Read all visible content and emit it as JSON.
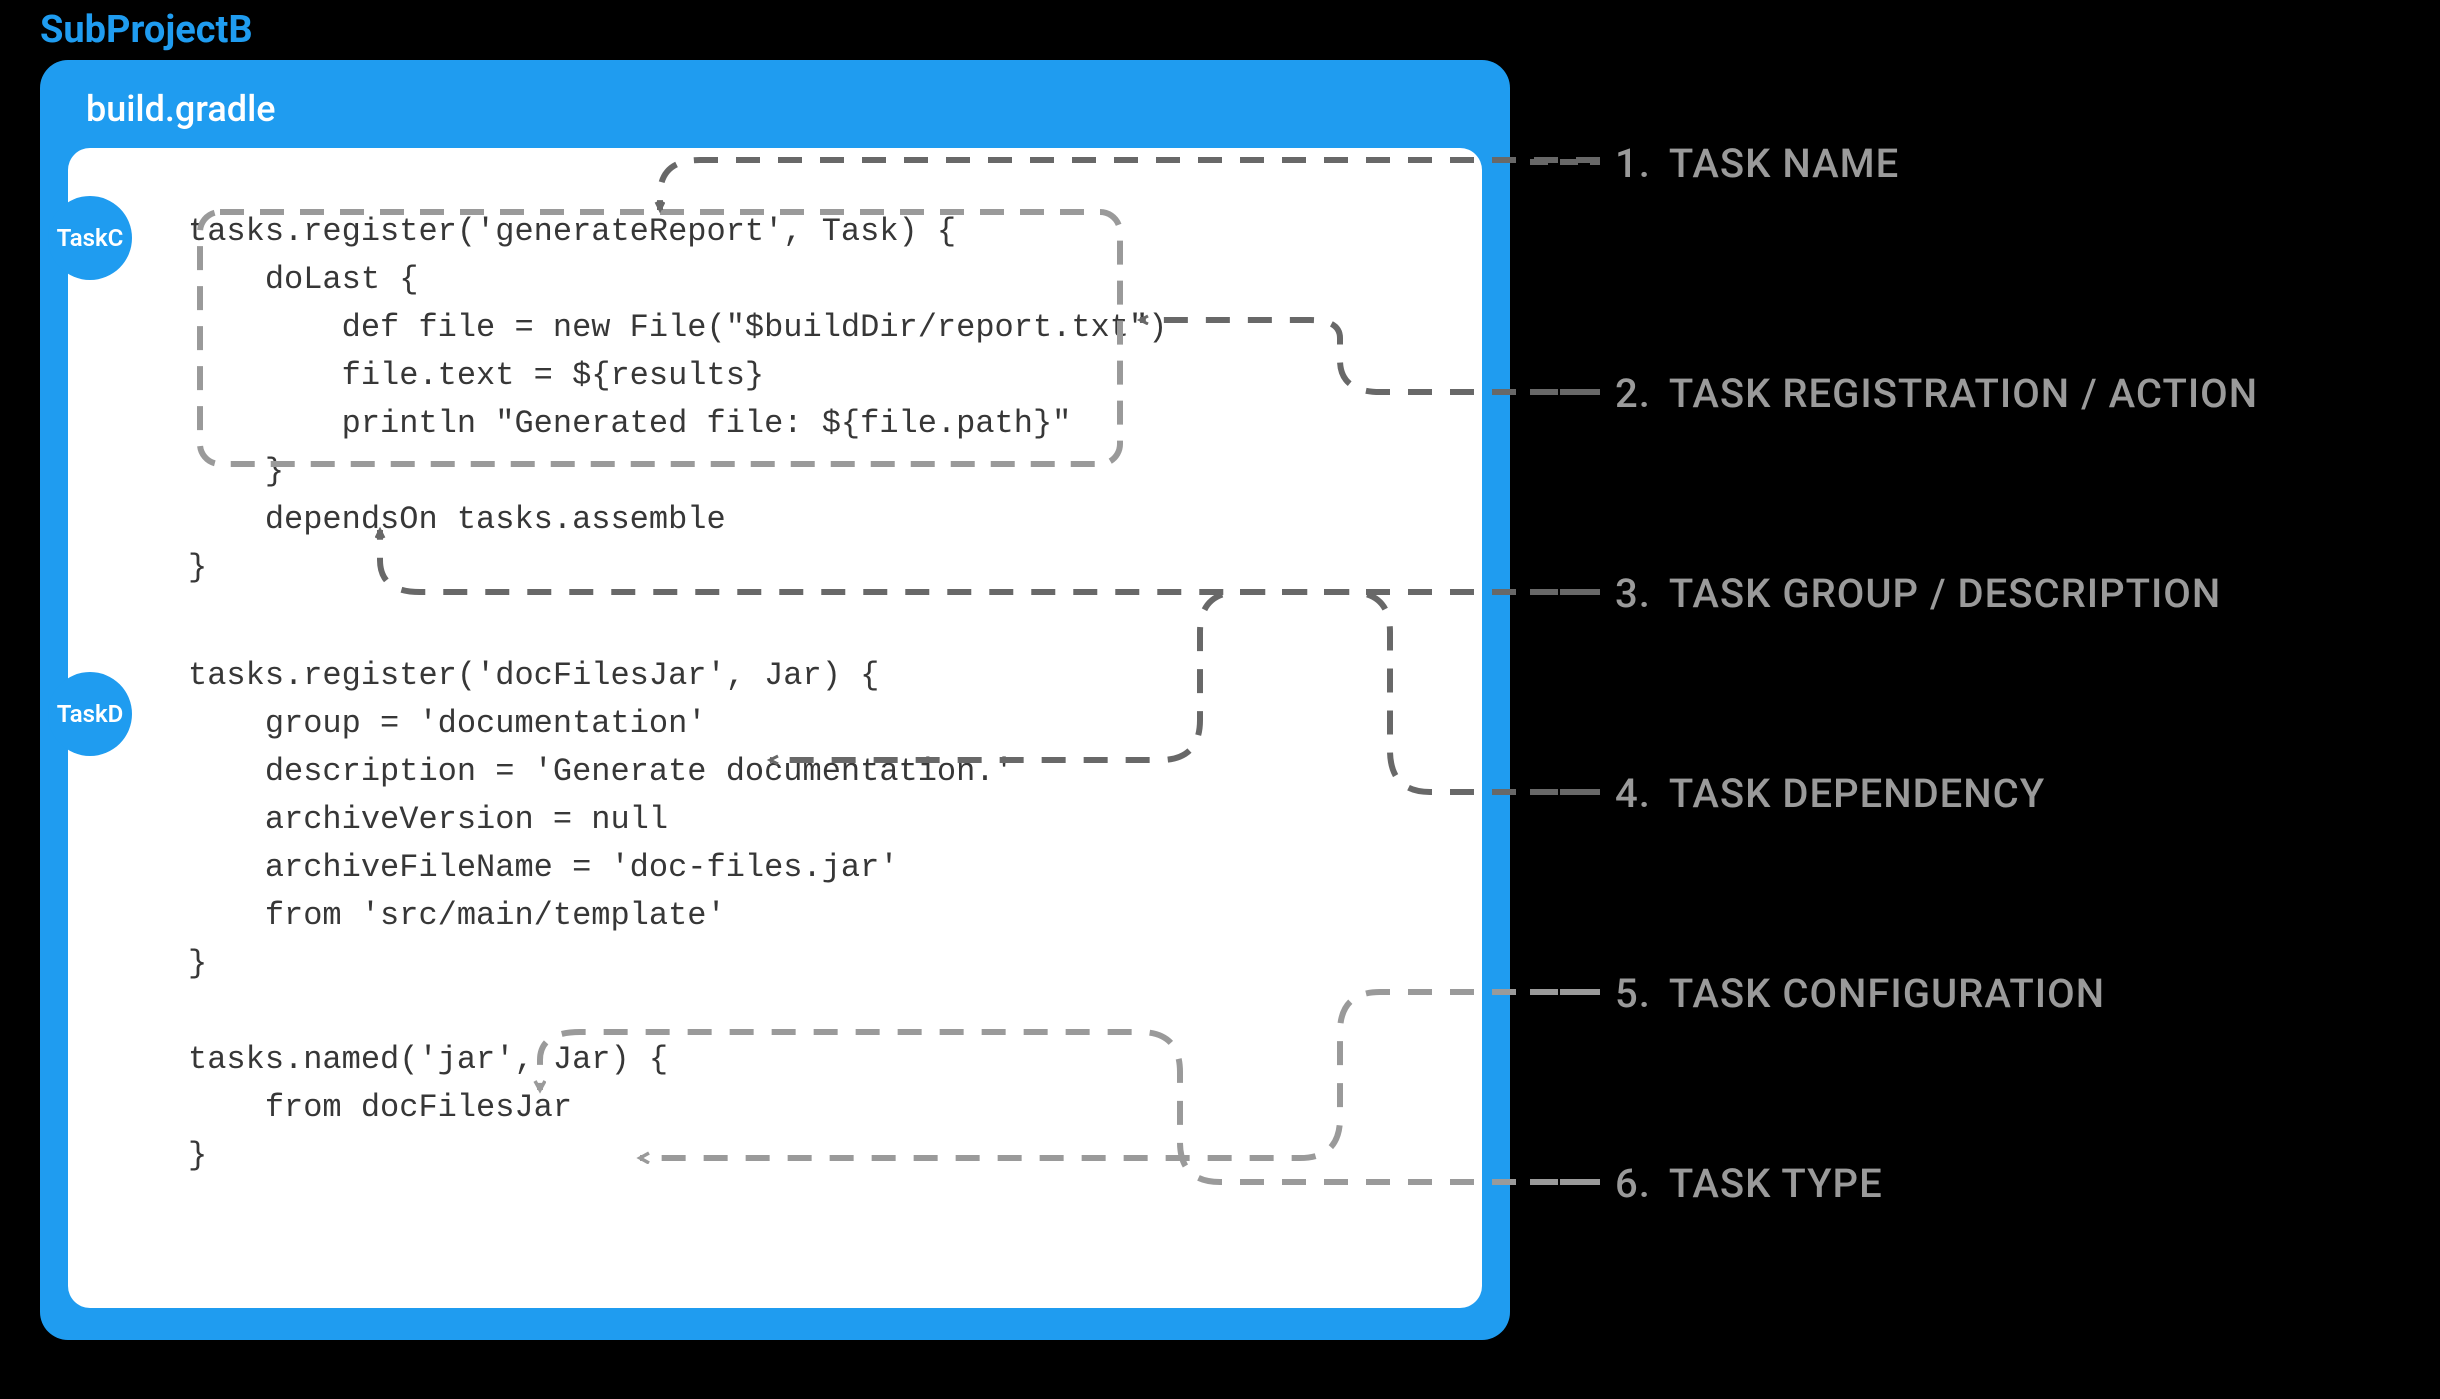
{
  "project": {
    "title": "SubProjectB"
  },
  "file": {
    "name": "build.gradle"
  },
  "badges": {
    "c": "TaskC",
    "d": "TaskD"
  },
  "code": {
    "taskC": "tasks.register('generateReport', Task) {\n    doLast {\n        def file = new File(\"$buildDir/report.txt\")\n        file.text = ${results}\n        println \"Generated file: ${file.path}\"\n    }\n    dependsOn tasks.assemble\n}",
    "taskD": "tasks.register('docFilesJar', Jar) {\n    group = 'documentation'\n    description = 'Generate documentation.'\n    archiveVersion = null\n    archiveFileName = 'doc-files.jar'\n    from 'src/main/template'\n}",
    "taskJar": "tasks.named('jar', Jar) {\n    from docFilesJar\n}"
  },
  "annotations": [
    {
      "num": "1.",
      "label": "TASK NAME"
    },
    {
      "num": "2.",
      "label": "TASK REGISTRATION / ACTION"
    },
    {
      "num": "3.",
      "label": "TASK GROUP / DESCRIPTION"
    },
    {
      "num": "4.",
      "label": "TASK DEPENDENCY"
    },
    {
      "num": "5.",
      "label": "TASK CONFIGURATION"
    },
    {
      "num": "6.",
      "label": "TASK TYPE"
    }
  ],
  "colors": {
    "accent": "#1f9cf0",
    "annotation": "#9a9a9a",
    "dash": "#686868"
  }
}
